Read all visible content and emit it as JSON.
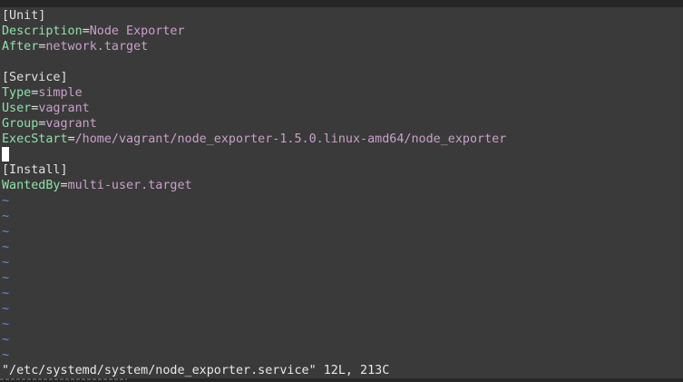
{
  "file": {
    "lines": [
      {
        "type": "section",
        "text": "[Unit]"
      },
      {
        "type": "kv",
        "key": "Description",
        "value": "Node Exporter"
      },
      {
        "type": "kv",
        "key": "After",
        "value": "network.target"
      },
      {
        "type": "empty"
      },
      {
        "type": "section",
        "text": "[Service]"
      },
      {
        "type": "kv",
        "key": "Type",
        "value": "simple"
      },
      {
        "type": "kv",
        "key": "User",
        "value": "vagrant"
      },
      {
        "type": "kv",
        "key": "Group",
        "value": "vagrant"
      },
      {
        "type": "kv",
        "key": "ExecStart",
        "value": "/home/vagrant/node_exporter-1.5.0.linux-amd64/node_exporter"
      },
      {
        "type": "cursor"
      },
      {
        "type": "section",
        "text": "[Install]"
      },
      {
        "type": "kv",
        "key": "WantedBy",
        "value": "multi-user.target"
      }
    ],
    "filler_count": 11,
    "filler_char": "~",
    "equals_char": "="
  },
  "status": {
    "message": "\"/etc/systemd/system/node_exporter.service\" 12L, 213C"
  },
  "colors": {
    "background": "#3a3a3a",
    "key": "#8fe0a8",
    "value": "#c8a0c8",
    "tilde": "#5f8fd8",
    "text": "#e0e0e0"
  }
}
